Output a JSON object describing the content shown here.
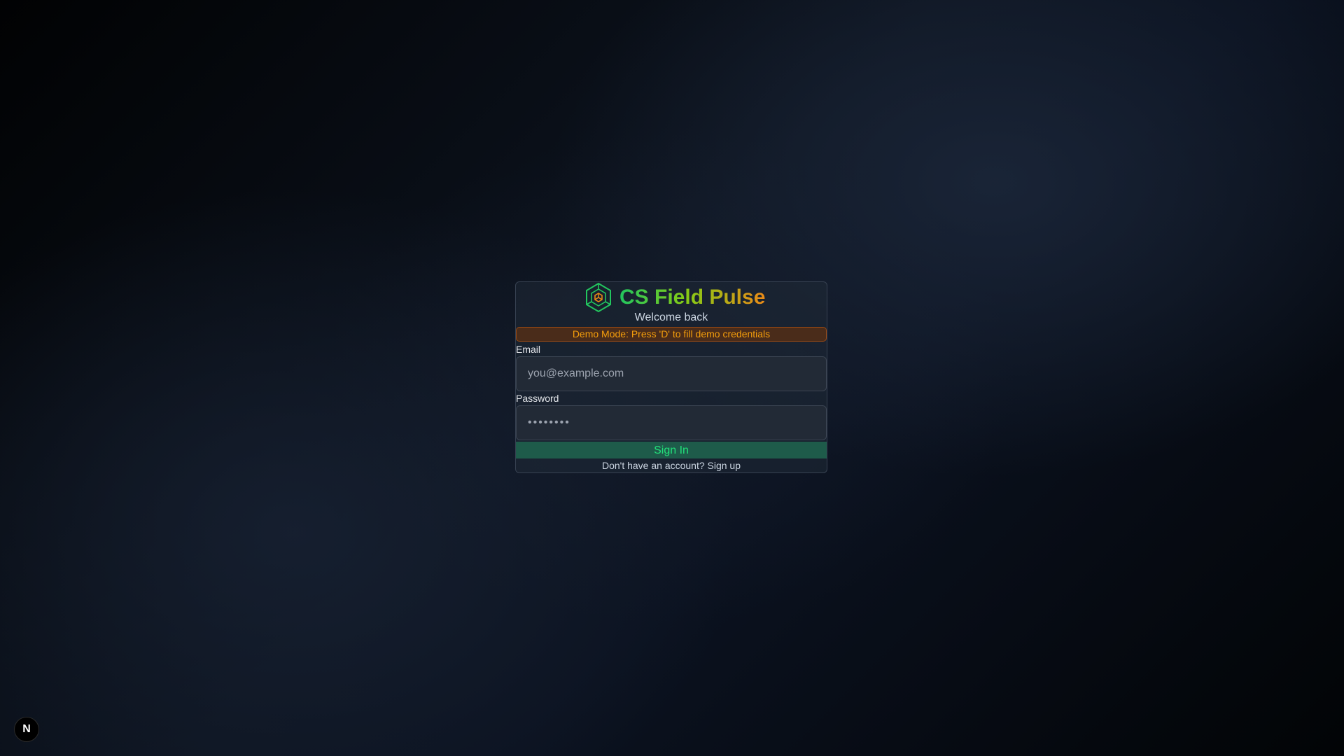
{
  "app": {
    "title": "CS Field Pulse",
    "subtitle": "Welcome back",
    "logo_icon": "hexagon-cube-icon"
  },
  "demo_banner": {
    "text": "Demo Mode: Press 'D' to fill demo credentials",
    "color": "#f59e0b"
  },
  "form": {
    "email_label": "Email",
    "email_placeholder": "you@example.com",
    "email_value": "",
    "password_label": "Password",
    "password_placeholder": "••••••••",
    "password_value": "",
    "submit_label": "Sign In"
  },
  "footer": {
    "signup_text": "Don't have an account? Sign up"
  },
  "dev_badge": {
    "letter": "N",
    "icon": "nextjs-devtools-icon"
  },
  "colors": {
    "brand_green": "#22c55e",
    "brand_orange": "#ea8a17",
    "button_bg": "#1e5b4a",
    "button_text": "#22e07a"
  }
}
